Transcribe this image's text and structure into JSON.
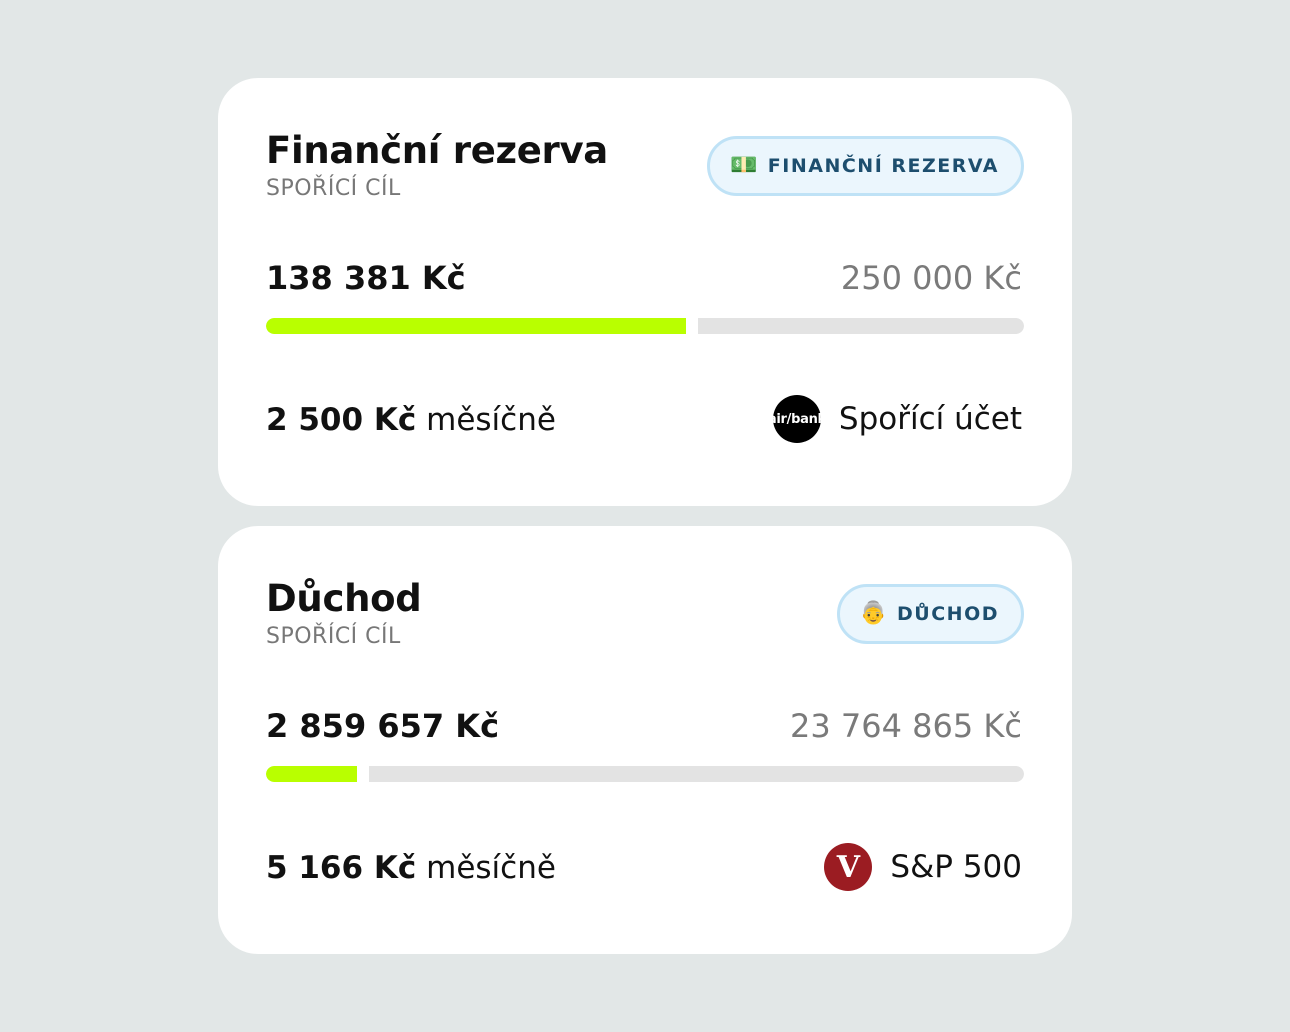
{
  "colors": {
    "background": "#e2e7e7",
    "card": "#ffffff",
    "progress_fill": "#b9ff00",
    "progress_track": "#e3e3e3",
    "tag_border": "#bfe2f6",
    "tag_text": "#1d4e6e"
  },
  "goals": [
    {
      "title": "Finanční rezerva",
      "subtitle": "SPOŘÍCÍ CÍL",
      "tag": {
        "emoji": "💵",
        "icon": "money-icon",
        "label": "FINANČNÍ REZERVA"
      },
      "current": "138 381 Kč",
      "target": "250 000 Kč",
      "progress": 0.5535,
      "monthly_amount": "2 500 Kč",
      "monthly_suffix": "měsíčně",
      "account": {
        "logo": "air/bank",
        "logo_icon": "air-bank-logo",
        "name": "Spořící účet"
      }
    },
    {
      "title": "Důchod",
      "subtitle": "SPOŘÍCÍ CÍL",
      "tag": {
        "emoji": "👵",
        "icon": "old-woman-icon",
        "label": "DŮCHOD"
      },
      "current": "2 859 657 Kč",
      "target": "23 764 865 Kč",
      "progress": 0.1203,
      "monthly_amount": "5 166 Kč",
      "monthly_suffix": "měsíčně",
      "account": {
        "logo": "V",
        "logo_icon": "vanguard-logo",
        "name": "S&P 500"
      }
    }
  ]
}
